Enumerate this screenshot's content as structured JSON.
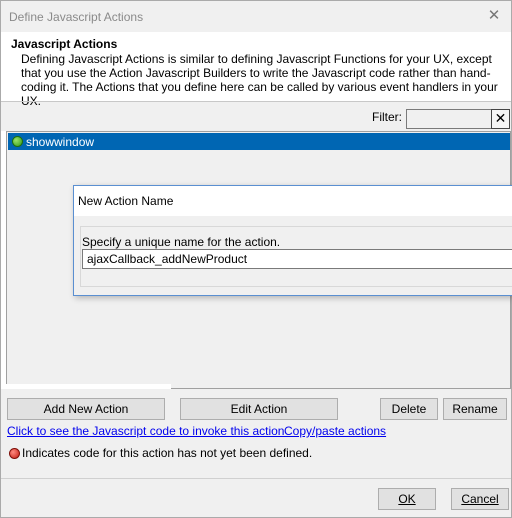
{
  "window": {
    "title": "Define Javascript Actions",
    "close_glyph": "✕"
  },
  "header": {
    "title": "Javascript Actions",
    "description": "Defining Javascript Actions is similar to defining Javascript Functions for your UX, except that you use the Action Javascript Builders to write the Javascript code rather than hand-coding it. The Actions that you define here can be called by various event handlers in your UX."
  },
  "filter": {
    "label": "Filter:",
    "value": "",
    "clear_glyph": "✕"
  },
  "actions_list": {
    "items": [
      {
        "label": "showwindow",
        "status_icon": "green-dot-icon",
        "selected": true
      }
    ]
  },
  "buttons": {
    "add": "Add New Action",
    "edit": "Edit Action",
    "delete": "Delete",
    "rename": "Rename"
  },
  "links": {
    "invoke": "Click to see the Javascript code to invoke this action",
    "copy_paste": "Copy/paste actions"
  },
  "legend": {
    "icon": "red-dot-icon",
    "text": "Indicates code for this action has not yet been defined."
  },
  "footer": {
    "ok": "OK",
    "cancel": "Cancel"
  },
  "new_action_dialog": {
    "title": "New Action Name",
    "prompt": "Specify a unique name for the action.",
    "value": "ajaxCallback_addNewProduct"
  },
  "colors": {
    "selection": "#0066b3",
    "link": "#0000ee",
    "dialog_border": "#5a8fd1"
  }
}
